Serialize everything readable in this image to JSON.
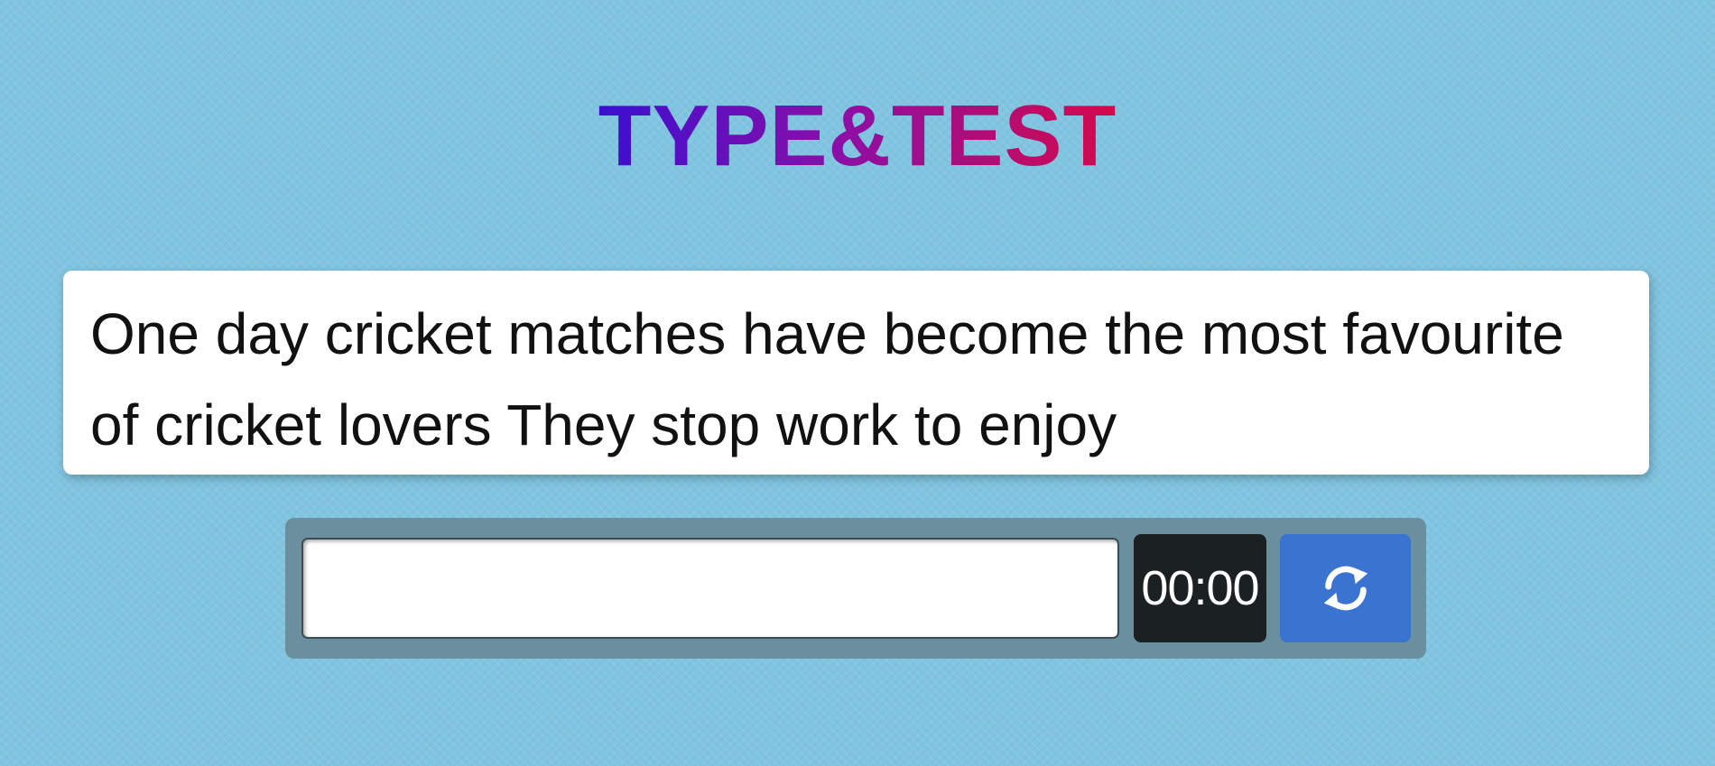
{
  "header": {
    "title": "TYPE&TEST",
    "title_gradient": [
      "#3a0fd0",
      "#8a0fa8",
      "#d40a4a"
    ]
  },
  "quote": {
    "text": "One day cricket matches have become the most favourite of cricket lovers They stop work to enjoy"
  },
  "controls": {
    "input_value": "",
    "timer": "00:00",
    "reset_icon": "refresh-icon",
    "reset_button_color": "#3a74d0"
  },
  "theme": {
    "background": "#80c4e0",
    "card": "#ffffff",
    "controls_bar": "#6a909f",
    "timer_bg": "#1b2023"
  }
}
